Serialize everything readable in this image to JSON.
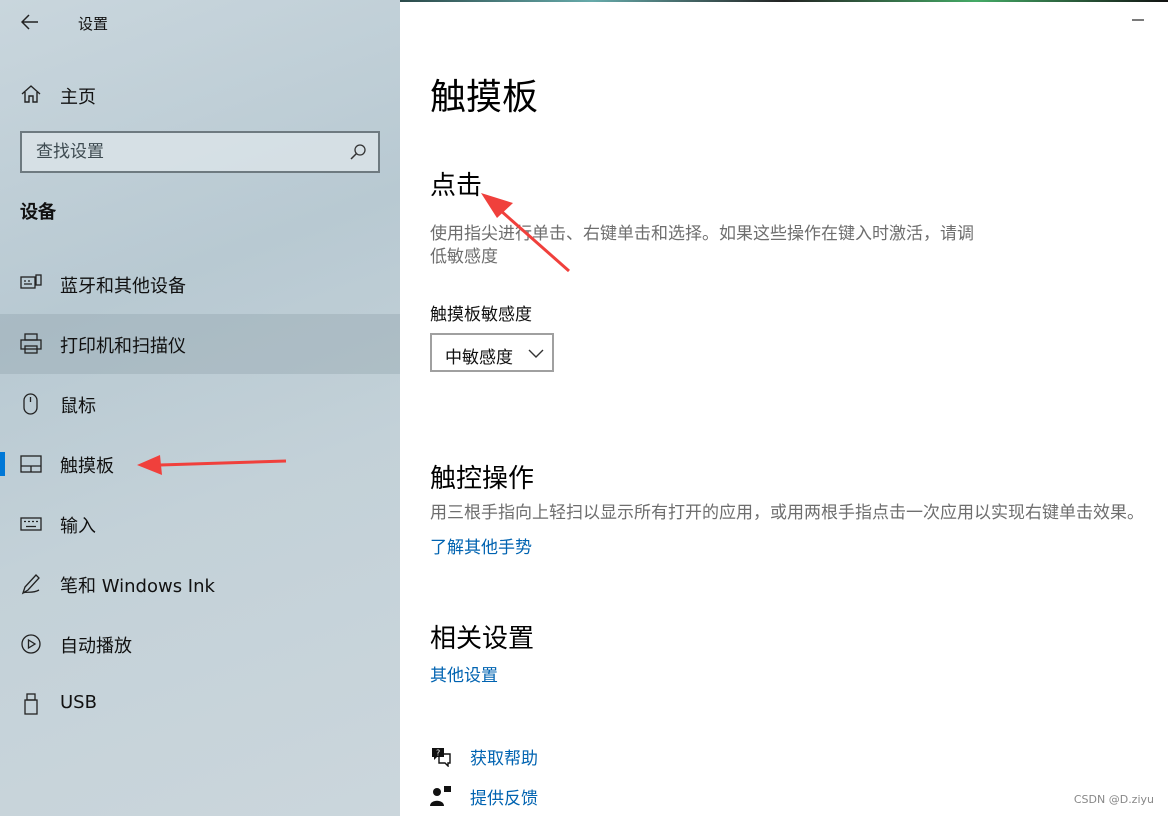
{
  "window": {
    "app_title": "设置",
    "back_icon": "arrow-left-icon",
    "close_icon": "close-icon"
  },
  "sidebar": {
    "home": {
      "label": "主页",
      "icon": "home-icon"
    },
    "search": {
      "placeholder": "查找设置",
      "icon": "search-icon"
    },
    "section_title": "设备",
    "items": [
      {
        "label": "蓝牙和其他设备",
        "icon": "bluetooth-devices-icon"
      },
      {
        "label": "打印机和扫描仪",
        "icon": "printer-icon"
      },
      {
        "label": "鼠标",
        "icon": "mouse-icon"
      },
      {
        "label": "触摸板",
        "icon": "touchpad-icon",
        "selected": true
      },
      {
        "label": "输入",
        "icon": "keyboard-icon"
      },
      {
        "label": "笔和 Windows Ink",
        "icon": "pen-icon"
      },
      {
        "label": "自动播放",
        "icon": "autoplay-icon"
      },
      {
        "label": "USB",
        "icon": "usb-icon"
      }
    ]
  },
  "main": {
    "title": "触摸板",
    "tap": {
      "heading": "点击",
      "description_line1": "使用指尖进行单击、右键单击和选择。如果这些操作在键入时激活，请调",
      "description_line2": "低敏感度",
      "sensitivity_label": "触摸板敏感度",
      "sensitivity_value": "中敏感度"
    },
    "gestures": {
      "heading": "触控操作",
      "description": "用三根手指向上轻扫以显示所有打开的应用，或用两根手指点击一次应用以实现右键单击效果。",
      "link": "了解其他手势"
    },
    "related": {
      "heading": "相关设置",
      "link": "其他设置"
    },
    "help": {
      "get_help": "获取帮助",
      "feedback": "提供反馈"
    }
  },
  "watermark": "CSDN @D.ziyu",
  "colors": {
    "accent": "#0078d7",
    "link": "#0063b1",
    "annotation_arrow": "#f0403c"
  }
}
